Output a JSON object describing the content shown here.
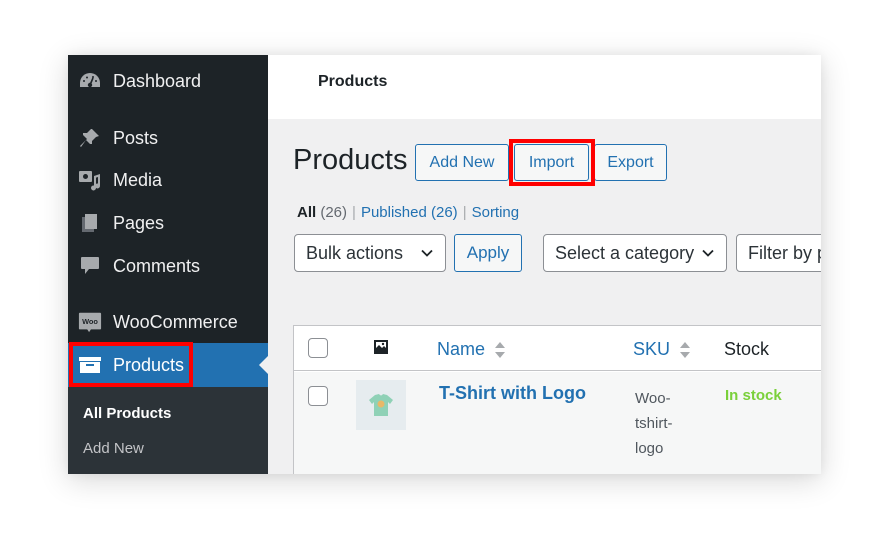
{
  "sidebar": {
    "items": [
      {
        "label": "Dashboard",
        "icon": "dashboard-icon"
      },
      {
        "label": "Posts",
        "icon": "pin-icon"
      },
      {
        "label": "Media",
        "icon": "media-icon"
      },
      {
        "label": "Pages",
        "icon": "pages-icon"
      },
      {
        "label": "Comments",
        "icon": "comment-icon"
      },
      {
        "label": "WooCommerce",
        "icon": "woo-icon",
        "icon_text": "Woo"
      },
      {
        "label": "Products",
        "icon": "archive-box-icon",
        "current": true
      }
    ],
    "submenu": [
      {
        "label": "All Products",
        "active": true
      },
      {
        "label": "Add New"
      }
    ]
  },
  "header": {
    "title": "Products"
  },
  "page": {
    "title": "Products",
    "buttons": {
      "add_new": "Add New",
      "import": "Import",
      "export": "Export"
    }
  },
  "filters": {
    "views": [
      {
        "label": "All",
        "count": "(26)",
        "current": true
      },
      {
        "label": "Published",
        "count": "(26)"
      },
      {
        "label": "Sorting"
      }
    ],
    "separator": "|",
    "bulk_actions": "Bulk actions",
    "apply": "Apply",
    "category": "Select a category",
    "product_type": "Filter by product type"
  },
  "table": {
    "columns": {
      "image": "image-icon",
      "name": "Name",
      "sku": "SKU",
      "stock": "Stock"
    },
    "rows": [
      {
        "name": "T-Shirt with Logo",
        "sku": "Woo-tshirt-logo",
        "sku_lines": [
          "Woo-",
          "tshirt-",
          "logo"
        ],
        "stock": "In stock",
        "thumbnail": "t-shirt-thumbnail"
      }
    ]
  },
  "colors": {
    "sidebar_bg": "#1d2327",
    "accent": "#2271b1",
    "highlight": "#ff0000",
    "in_stock": "#7ad03a"
  }
}
